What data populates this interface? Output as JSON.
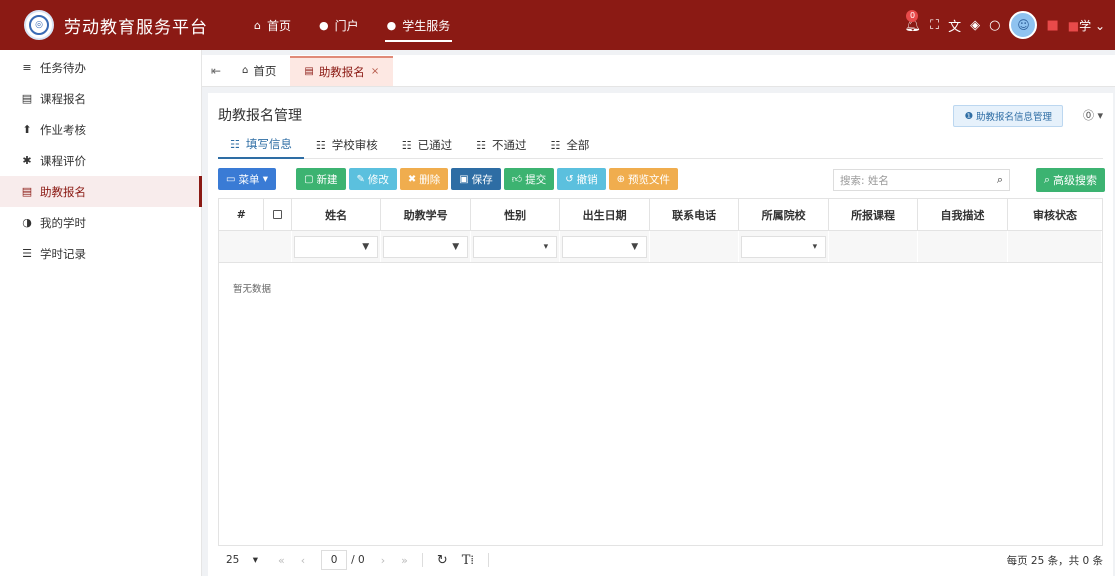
{
  "app": {
    "title": "劳动教育服务平台"
  },
  "topnav": [
    {
      "label": "首页",
      "icon": "home-icon"
    },
    {
      "label": "门户",
      "icon": "dot-icon"
    },
    {
      "label": "学生服务",
      "icon": "dot-icon"
    }
  ],
  "header": {
    "notification_count": "0",
    "user_label": "学"
  },
  "sidebar": {
    "items": [
      {
        "label": "任务待办",
        "icon": "list-icon"
      },
      {
        "label": "课程报名",
        "icon": "card-icon"
      },
      {
        "label": "作业考核",
        "icon": "upload-icon"
      },
      {
        "label": "课程评价",
        "icon": "star-icon"
      },
      {
        "label": "助教报名",
        "icon": "card-icon"
      },
      {
        "label": "我的学时",
        "icon": "pie-icon"
      },
      {
        "label": "学时记录",
        "icon": "menu-icon"
      }
    ]
  },
  "tabs": [
    {
      "label": "首页"
    },
    {
      "label": "助教报名"
    }
  ],
  "page": {
    "title": "助教报名管理",
    "info_button": "助教报名信息管理"
  },
  "subtabs": [
    {
      "label": "填写信息"
    },
    {
      "label": "学校审核"
    },
    {
      "label": "已通过"
    },
    {
      "label": "不通过"
    },
    {
      "label": "全部"
    }
  ],
  "toolbar": {
    "menu": "菜单",
    "new": "新建",
    "edit": "修改",
    "delete": "删除",
    "save": "保存",
    "submit": "提交",
    "revoke": "撤销",
    "preview": "预览文件",
    "search_placeholder": "搜索: 姓名",
    "advanced_search": "高级搜索"
  },
  "colors": {
    "brand": "#8b1a14",
    "primary": "#2e6da4",
    "success": "#3cb371",
    "info": "#5bc0de",
    "warning": "#f0ad4e"
  },
  "table": {
    "columns": [
      "#",
      "",
      "姓名",
      "助教学号",
      "性别",
      "出生日期",
      "联系电话",
      "所属院校",
      "所报课程",
      "自我描述",
      "审核状态"
    ],
    "empty_text": "暂无数据"
  },
  "pager": {
    "page_size": "25",
    "current_page": "0",
    "total_pages": "/ 0",
    "summary": "每页 25 条，共 0 条"
  }
}
